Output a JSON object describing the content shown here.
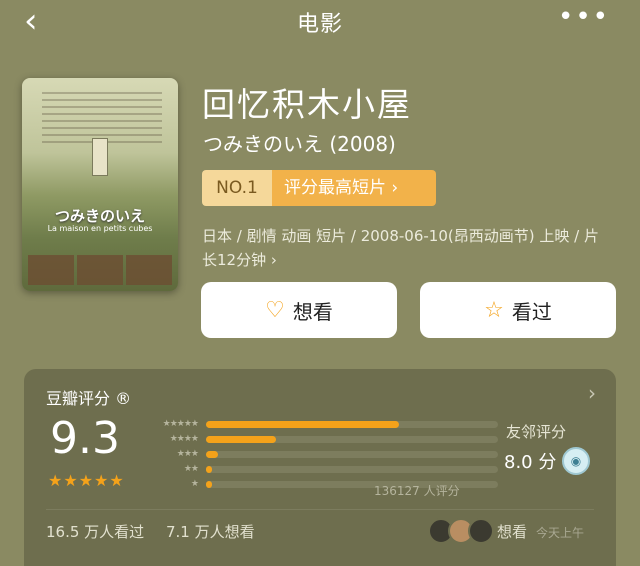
{
  "nav": {
    "back_icon": "chevron-left-icon",
    "title": "电影",
    "more_icon": "more-dots-icon"
  },
  "poster": {
    "title": "つみきのいえ",
    "subtitle": "La maison en petits cubes"
  },
  "movie": {
    "title": "回忆积木小屋",
    "original_title": "つみきのいえ (2008)",
    "rank_no": "NO.1",
    "rank_label": "评分最高短片 ›",
    "meta": "日本 / 剧情 动画 短片 / 2008-06-10(昂西动画节) 上映 / 片长12分钟 ›"
  },
  "actions": {
    "want": "想看",
    "seen": "看过"
  },
  "rating": {
    "section_title": "豆瓣评分 ®",
    "score": "9.3",
    "stars": "★★★★★",
    "star_value": 4.5,
    "distribution": [
      {
        "label": "★★★★★",
        "percent": 66
      },
      {
        "label": "★★★★",
        "percent": 24
      },
      {
        "label": "★★★",
        "percent": 4
      },
      {
        "label": "★★",
        "percent": 2
      },
      {
        "label": "★",
        "percent": 2
      }
    ],
    "count_text": "136127 人评分",
    "friend_label": "友邻评分",
    "friend_score": "8.0 分",
    "seen_count": "16.5 万人看过",
    "want_count": "7.1 万人想看",
    "friend_action": "想看",
    "friend_time": "今天上午"
  },
  "colors": {
    "background": "#8a8a62",
    "accent": "#f4a21a"
  }
}
